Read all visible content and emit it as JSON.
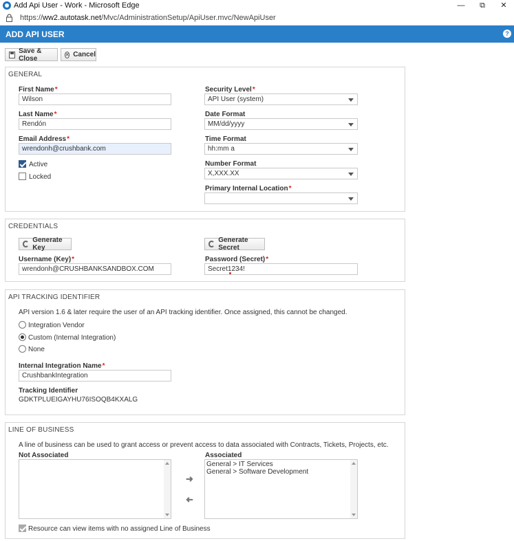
{
  "window": {
    "title": "Add Api User - Work - Microsoft Edge",
    "minimize": "—",
    "maximize": "⧉",
    "close": "✕"
  },
  "address": {
    "prefix": "https://",
    "host": "ww2.autotask.net",
    "path": "/Mvc/AdministrationSetup/ApiUser.mvc/NewApiUser"
  },
  "header": {
    "title": "ADD API USER",
    "help": "?"
  },
  "toolbar": {
    "save_close": "Save & Close",
    "cancel": "Cancel"
  },
  "general": {
    "heading": "GENERAL",
    "first_name_label": "First Name",
    "first_name": "Wilson",
    "last_name_label": "Last Name",
    "last_name": "Rendón",
    "email_label": "Email Address",
    "email": "wrendonh@crushbank.com",
    "active_label": "Active",
    "active": true,
    "locked_label": "Locked",
    "locked": false,
    "security_label": "Security Level",
    "security": "API User (system)",
    "date_label": "Date Format",
    "date": "MM/dd/yyyy",
    "time_label": "Time Format",
    "time": "hh:mm a",
    "number_label": "Number Format",
    "number": "X,XXX.XX",
    "location_label": "Primary Internal Location",
    "location": ""
  },
  "credentials": {
    "heading": "CREDENTIALS",
    "gen_key": "Generate Key",
    "gen_secret": "Generate Secret",
    "username_label": "Username (Key)",
    "username": "wrendonh@CRUSHBANKSANDBOX.COM",
    "password_label": "Password (Secret)",
    "password": "Secret1234!"
  },
  "tracking": {
    "heading": "API TRACKING IDENTIFIER",
    "description": "API version 1.6 & later require the user of an API tracking identifier. Once assigned, this cannot be changed.",
    "options": [
      "Integration Vendor",
      "Custom (Internal Integration)",
      "None"
    ],
    "selected": "Custom (Internal Integration)",
    "integration_name_label": "Internal Integration Name",
    "integration_name": "CrushbankIntegration",
    "tracking_label": "Tracking Identifier",
    "tracking_value": "GDKTPLUEIGAYHU76ISOQB4KXALG"
  },
  "lob": {
    "heading": "LINE OF BUSINESS",
    "description": "A line of business can be used to grant access or prevent access to data associated with Contracts, Tickets, Projects, etc.",
    "not_associated_label": "Not Associated",
    "associated_label": "Associated",
    "associated": [
      "General > IT Services",
      "General > Software Development"
    ],
    "resource_label": "Resource can view items with no assigned Line of Business",
    "resource_checked": true
  }
}
